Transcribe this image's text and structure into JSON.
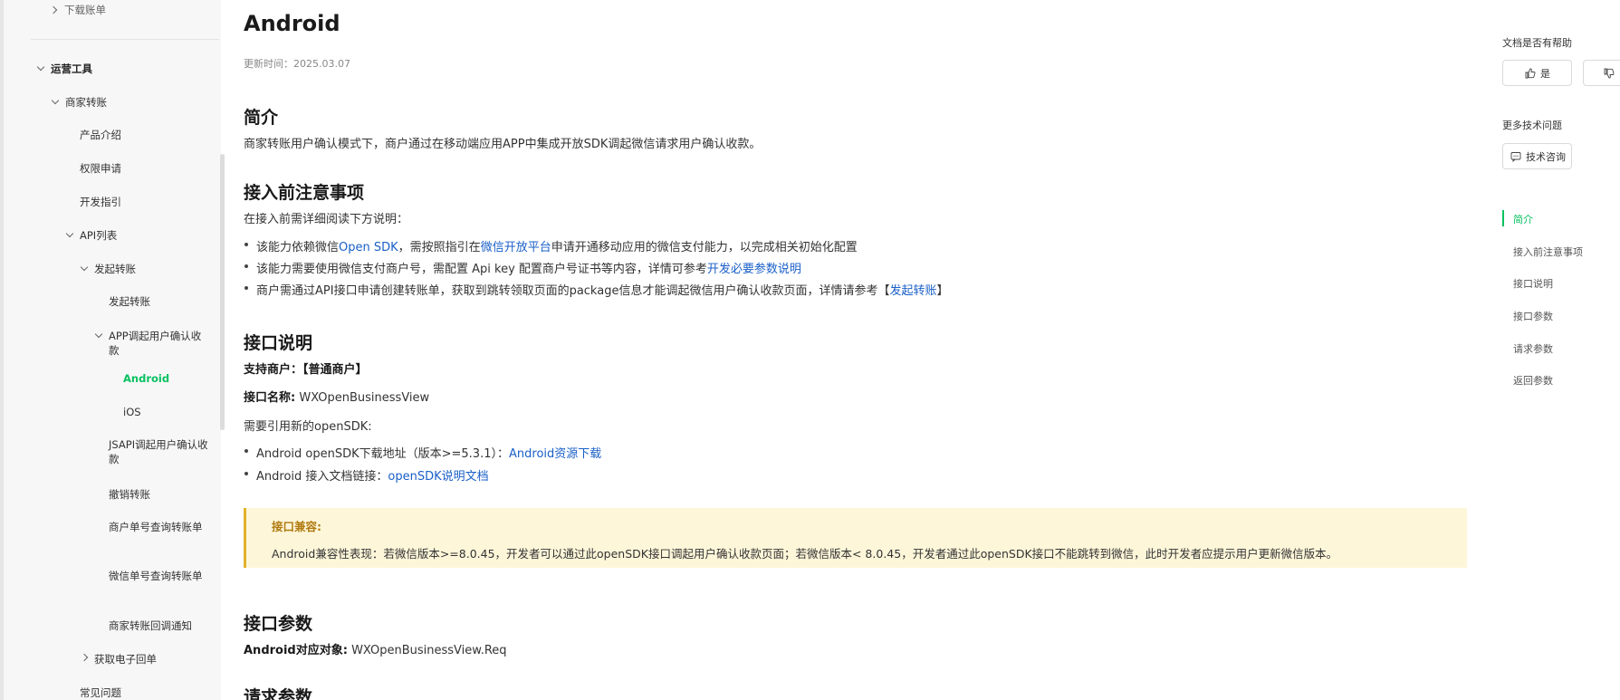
{
  "sidebar": {
    "top_cut": "下载账单",
    "section": "运营工具",
    "group": "商家转账",
    "items": {
      "intro": "产品介绍",
      "permission": "权限申请",
      "guide": "开发指引",
      "api_list": "API列表",
      "initiate_group": "发起转账",
      "initiate": "发起转账",
      "app_confirm": "APP调起用户确认收款",
      "android": "Android",
      "ios": "iOS",
      "jsapi": "JSAPI调起用户确认收款",
      "cancel": "撤销转账",
      "query_merchant": "商户单号查询转账单",
      "query_wechat": "微信单号查询转账单",
      "callback": "商家转账回调通知",
      "receipt": "获取电子回单",
      "faq": "常见问题"
    }
  },
  "main": {
    "title": "Android",
    "update_time": "更新时间：2025.03.07",
    "intro": {
      "heading": "简介",
      "text": "商家转账用户确认模式下，商户通过在移动端应用APP中集成开放SDK调起微信请求用户确认收款。"
    },
    "before": {
      "heading": "接入前注意事项",
      "lead": "在接入前需详细阅读下方说明：",
      "b1_pre": "该能力依赖微信",
      "b1_link1": "Open SDK",
      "b1_mid": "，需按照指引在",
      "b1_link2": "微信开放平台",
      "b1_post": "申请开通移动应用的微信支付能力，以完成相关初始化配置",
      "b2_pre": "该能力需要使用微信支付商户号，需配置 Api key 配置商户号证书等内容，详情可参考",
      "b2_link": "开发必要参数说明",
      "b3_pre": "商户需通过API接口申请创建转账单，获取到跳转领取页面的package信息才能调起微信用户确认收款页面，详情请参考【",
      "b3_link": "发起转账",
      "b3_post": "】"
    },
    "api_desc": {
      "heading": "接口说明",
      "support_label": "支持商户：",
      "support_value": "【普通商户】",
      "name_label": "接口名称:",
      "name_value": "WXOpenBusinessView",
      "sdk_note": "需要引用新的openSDK:",
      "d1_pre": "Android openSDK下载地址（版本>=5.3.1）：",
      "d1_link": "Android资源下载",
      "d2_pre": "Android 接入文档链接：",
      "d2_link": "openSDK说明文档"
    },
    "notice": {
      "title": "接口兼容:",
      "body": "Android兼容性表现：若微信版本>=8.0.45，开发者可以通过此openSDK接口调起用户确认收款页面；若微信版本< 8.0.45，开发者通过此openSDK接口不能跳转到微信，此时开发者应提示用户更新微信版本。"
    },
    "params": {
      "heading": "接口参数",
      "obj_label": "Android对应对象:",
      "obj_value": "WXOpenBusinessView.Req"
    },
    "req_heading": "请求参数"
  },
  "right": {
    "helpful": "文档是否有帮助",
    "yes": "是",
    "more": "更多技术问题",
    "consult": "技术咨询",
    "toc": [
      "简介",
      "接入前注意事项",
      "接口说明",
      "接口参数",
      "请求参数",
      "返回参数"
    ]
  }
}
